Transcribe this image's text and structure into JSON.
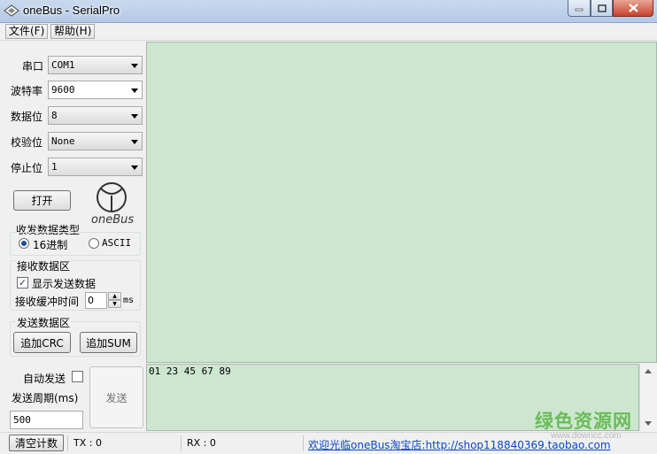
{
  "window": {
    "title": "oneBus - SerialPro"
  },
  "menu": [
    {
      "label": "文件(F)"
    },
    {
      "label": "帮助(H)"
    }
  ],
  "settings": {
    "port_label": "串口",
    "port_value": "COM1",
    "baud_label": "波特率",
    "baud_value": "9600",
    "databits_label": "数据位",
    "databits_value": "8",
    "parity_label": "校验位",
    "parity_value": "None",
    "stopbits_label": "停止位",
    "stopbits_value": "1"
  },
  "open_button": "打开",
  "logo": {
    "text": "oneBus"
  },
  "data_type": {
    "title": "收发数据类型",
    "hex_label": "16进制",
    "ascii_label": "ASCII",
    "selected": "16进制"
  },
  "receive": {
    "title": "接收数据区",
    "show_sent_label": "显示发送数据",
    "show_sent_checked": true,
    "buffer_label": "接收缓冲时间",
    "buffer_value": "0",
    "buffer_unit": "ms"
  },
  "send_section": {
    "title": "发送数据区",
    "crc_button": "追加CRC",
    "sum_button": "追加SUM"
  },
  "auto_send": {
    "label": "自动发送",
    "checked": false,
    "period_label": "发送周期(ms)",
    "period_value": "500"
  },
  "send_button": "发送",
  "send_content": "01 23 45 67 89",
  "status": {
    "clear_button": "清空计数",
    "tx": "TX : 0",
    "rx": "RX : 0",
    "link": "欢迎光临oneBus淘宝店:http://shop118840369.taobao.com"
  },
  "watermark": {
    "main": "绿色资源网",
    "sub": "www.downcc.com"
  },
  "colors": {
    "receive_bg": "#cde6cf",
    "link": "#0b46c9",
    "watermark": "#54b23e"
  }
}
